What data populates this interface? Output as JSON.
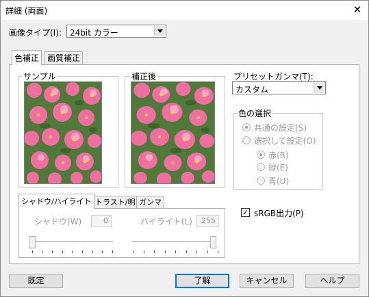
{
  "window": {
    "title": "詳細 (両面)",
    "close_glyph": "✕"
  },
  "image_type": {
    "label": "画像タイプ(I):",
    "value": "24bit カラー"
  },
  "tabs": [
    {
      "label": "色補正"
    },
    {
      "label": "画質補正"
    }
  ],
  "samples": {
    "before_label": "サンプル",
    "after_label": "補正後"
  },
  "preset": {
    "label": "プリセットガンマ(T):",
    "value": "カスタム"
  },
  "color_select": {
    "label": "色の選択",
    "common": "共通の設定(S)",
    "per_color": "選択して設定(O)",
    "red": "赤(R)",
    "green": "緑(E)",
    "blue": "青(U)"
  },
  "subtabs": [
    {
      "label": "シャドウ/ハイライト"
    },
    {
      "label": "コントラスト/明るさ"
    },
    {
      "label": "ガンマ"
    }
  ],
  "shadow": {
    "label": "シャドウ(W)",
    "value": "0"
  },
  "highlight": {
    "label": "ハイライト(L)",
    "value": "255"
  },
  "srgb": {
    "label": "sRGB出力(P)",
    "checked": true
  },
  "buttons": {
    "default": "既定",
    "ok": "了解",
    "cancel": "キャンセル",
    "help": "ヘルプ"
  },
  "colors": {
    "tab_border": "#adadad",
    "accent": "#0078d7",
    "disabled_text": "#9a9a9a"
  }
}
